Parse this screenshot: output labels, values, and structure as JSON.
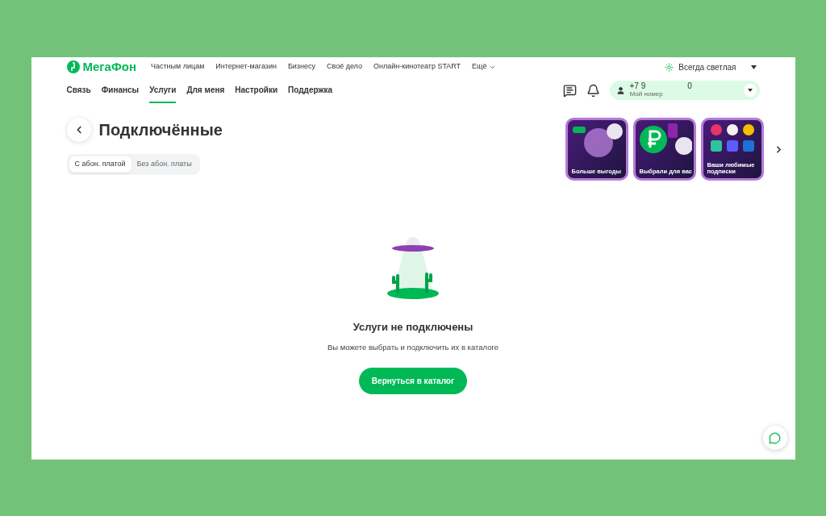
{
  "logo": {
    "text": "МегаФон"
  },
  "top_links": [
    "Частным лицам",
    "Интернет-магазин",
    "Бизнесу",
    "Своё дело",
    "Онлайн-кинотеатр START",
    "Ещё"
  ],
  "theme": {
    "label": "Всегда светлая"
  },
  "nav": [
    {
      "label": "Связь",
      "selected": false
    },
    {
      "label": "Финансы",
      "selected": false
    },
    {
      "label": "Услуги",
      "selected": true
    },
    {
      "label": "Для меня",
      "selected": false
    },
    {
      "label": "Настройки",
      "selected": false
    },
    {
      "label": "Поддержка",
      "selected": false
    }
  ],
  "account": {
    "phone_start": "+7 9",
    "phone_end": "0",
    "caption": "Мой номер"
  },
  "page": {
    "title": "Подключённые"
  },
  "segments": [
    {
      "label": "С абон. платой",
      "selected": true
    },
    {
      "label": "Без абон. платы",
      "selected": false
    }
  ],
  "stories": [
    {
      "kind": "cashback",
      "caption": "Больше выгоды"
    },
    {
      "kind": "ruble",
      "caption": "Выбрали для вас"
    },
    {
      "kind": "apps",
      "caption": "Ваши любимые подписки"
    }
  ],
  "empty": {
    "title": "Услуги не подключены",
    "text": "Вы можете выбрать и подключить их в каталоге",
    "button": "Вернуться в каталог"
  }
}
